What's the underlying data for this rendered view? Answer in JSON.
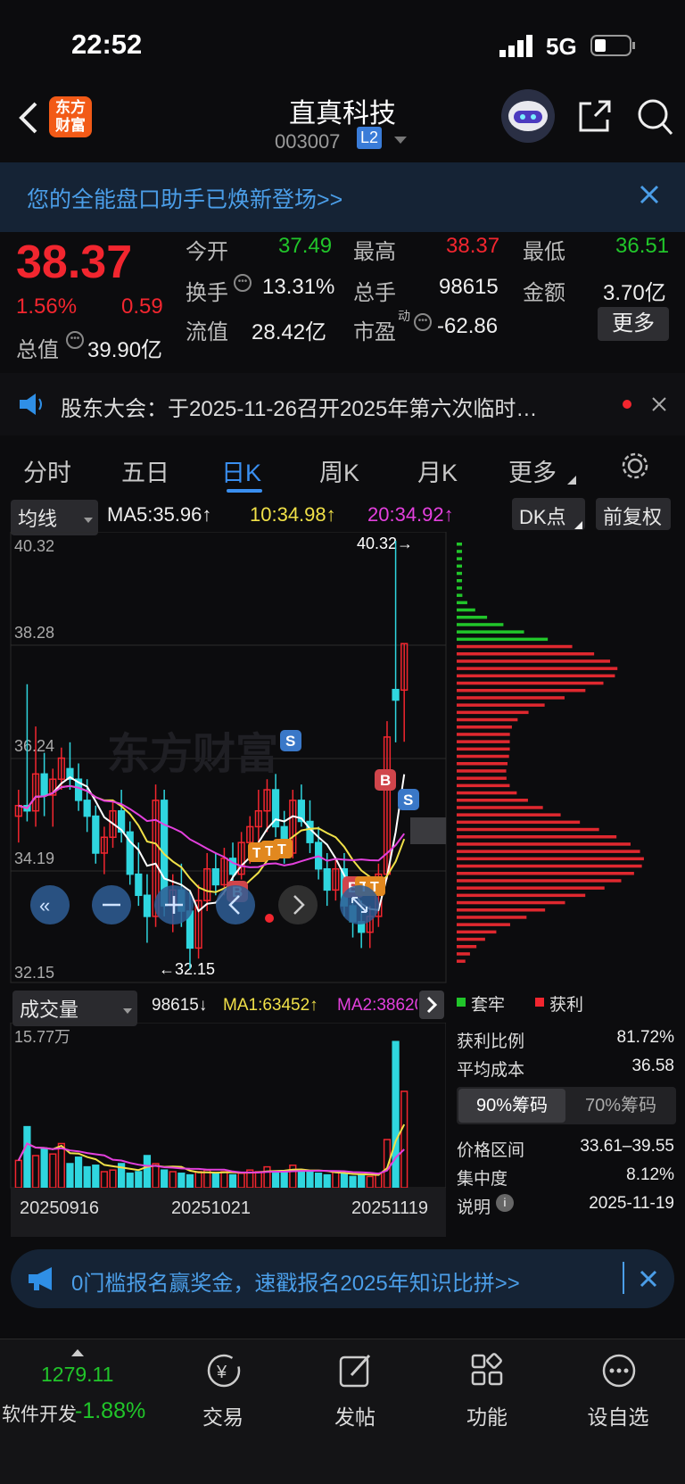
{
  "status": {
    "time": "22:52",
    "network": "5G"
  },
  "header": {
    "logo_line1": "东方",
    "logo_line2": "财富",
    "title": "直真科技",
    "code": "003007",
    "level": "L2"
  },
  "banner": {
    "text": "您的全能盘口助手已焕新登场>>"
  },
  "quote": {
    "price": "38.37",
    "change_pct": "1.56%",
    "change": "0.59",
    "open_label": "今开",
    "open": "37.49",
    "high_label": "最高",
    "high": "38.37",
    "low_label": "最低",
    "low": "36.51",
    "turnover_label": "换手",
    "turnover": "13.31%",
    "volume_label": "总手",
    "volume": "98615",
    "amount_label": "金额",
    "amount": "3.70亿",
    "total_value_label": "总值",
    "total_value": "39.90亿",
    "float_value_label": "流值",
    "float_value": "28.42亿",
    "pe_label": "市盈",
    "pe_sup": "动",
    "pe": "-62.86",
    "more_label": "更多"
  },
  "notice": {
    "text": "股东大会：于2025-11-26召开2025年第六次临时…"
  },
  "tabs": [
    "分时",
    "五日",
    "日K",
    "周K",
    "月K",
    "更多"
  ],
  "active_tab": "日K",
  "kline": {
    "indicator_select": "均线",
    "ma5": "MA5:35.96↑",
    "ma10": "10:34.98↑",
    "ma20": "20:34.92↑",
    "dk_label": "DK点",
    "fq_label": "前复权",
    "y_labels": [
      "40.32",
      "38.28",
      "36.24",
      "34.19",
      "32.15"
    ],
    "max_label": "40.32→",
    "min_label": "←32.15",
    "watermark": "东方财富"
  },
  "volume": {
    "select": "成交量",
    "value": "98615↓",
    "ma1": "MA1:63452↑",
    "ma2": "MA2:38620",
    "max_label": "15.77万",
    "dates": [
      "20250916",
      "20251021",
      "20251119"
    ]
  },
  "chips": {
    "legend_trapped": "套牢",
    "legend_profit": "获利",
    "rows": [
      {
        "label": "获利比例",
        "value": "81.72%"
      },
      {
        "label": "平均成本",
        "value": "36.58"
      }
    ],
    "tab_active": "90%筹码",
    "tab_inactive": "70%筹码",
    "rows2": [
      {
        "label": "价格区间",
        "value": "33.61–39.55"
      },
      {
        "label": "集中度",
        "value": "8.12%"
      },
      {
        "label": "说明",
        "value": "2025-11-19"
      }
    ]
  },
  "banner2": {
    "text": "0门槛报名赢奖金，速戳报名2025年知识比拼>>"
  },
  "nav": {
    "index_value": "1279.11",
    "index_name": "软件开发",
    "index_change": "-1.88%",
    "items": [
      "交易",
      "发帖",
      "功能",
      "设自选"
    ]
  },
  "colors": {
    "up": "#f2262f",
    "down": "#21c52a",
    "cyan": "#2fd6df",
    "accent": "#2f8fe6"
  }
}
